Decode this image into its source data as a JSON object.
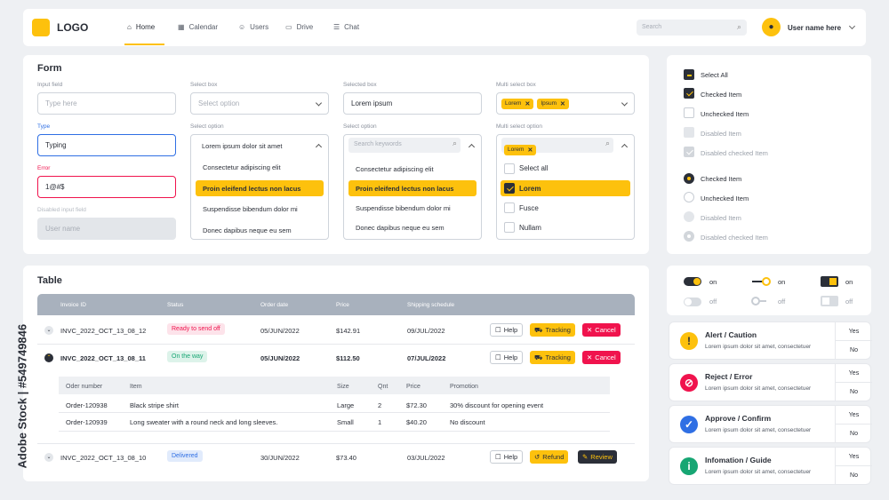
{
  "header": {
    "logo": "LOGO",
    "nav": [
      {
        "label": "Home",
        "icon": "home-icon"
      },
      {
        "label": "Calendar",
        "icon": "calendar-icon"
      },
      {
        "label": "Users",
        "icon": "users-icon"
      },
      {
        "label": "Drive",
        "icon": "folder-icon"
      },
      {
        "label": "Chat",
        "icon": "chat-icon"
      }
    ],
    "search_placeholder": "Search",
    "user_name": "User name here"
  },
  "form": {
    "title": "Form",
    "input_field": {
      "label": "Input field",
      "placeholder": "Type here"
    },
    "type_field": {
      "label": "Type",
      "value": "Typing"
    },
    "error_field": {
      "label": "Error",
      "value": "1@#$"
    },
    "disabled_field": {
      "label": "Disabled input field",
      "placeholder": "User name"
    },
    "select_box": {
      "label": "Select box",
      "placeholder": "Select option"
    },
    "select_option": {
      "label": "Select option",
      "value": "Lorem ipsum dolor sit amet",
      "options": [
        "Consectetur adipiscing elit",
        "Proin eleifend lectus non lacus",
        "Suspendisse bibendum dolor mi",
        "Donec dapibus neque eu sem"
      ]
    },
    "selected_box": {
      "label": "Selected box",
      "value": "Lorem ipsum"
    },
    "search_select": {
      "label": "Select option",
      "placeholder": "Search keywords",
      "options": [
        "Consectetur adipiscing elit",
        "Proin eleifend lectus non lacus",
        "Suspendisse bibendum dolor mi",
        "Donec dapibus neque eu sem"
      ]
    },
    "multi_select": {
      "label": "Multi select box",
      "chips": [
        "Lorem",
        "Ipsum"
      ]
    },
    "multi_option": {
      "label": "Multi select option",
      "chip": "Lorem",
      "options": [
        "Select all",
        "Lorem",
        "Fusce",
        "Nullam"
      ]
    }
  },
  "checks": {
    "items": [
      "Select All",
      "Checked Item",
      "Unchecked Item",
      "Disabled Item",
      "Disabled checked Item"
    ],
    "radios": [
      "Checked Item",
      "Unchecked Item",
      "Disabled Item",
      "Disabled checked Item"
    ]
  },
  "toggles": {
    "on": "on",
    "off": "off"
  },
  "table": {
    "title": "Table",
    "headers": [
      "Invoice ID",
      "Status",
      "Order date",
      "Price",
      "Shipping schedule"
    ],
    "rows": [
      {
        "id": "INVC_2022_OCT_13_08_12",
        "status": "Ready to send off",
        "date": "05/JUN/2022",
        "price": "$142.91",
        "ship": "09/JUL/2022",
        "b1": "Help",
        "b2": "Tracking",
        "b3": "Cancel"
      },
      {
        "id": "INVC_2022_OCT_13_08_11",
        "status": "On the way",
        "date": "05/JUN/2022",
        "price": "$112.50",
        "ship": "07/JUL/2022",
        "b1": "Help",
        "b2": "Tracking",
        "b3": "Cancel"
      },
      {
        "id": "INVC_2022_OCT_13_08_10",
        "status": "Delivered",
        "date": "30/JUN/2022",
        "price": "$73.40",
        "ship": "03/JUL/2022",
        "b1": "Help",
        "b2": "Refund",
        "b3": "Review"
      }
    ],
    "sub_headers": [
      "Oder number",
      "Item",
      "Size",
      "Qnt",
      "Price",
      "Promotion"
    ],
    "sub_rows": [
      {
        "num": "Order-120938",
        "item": "Black stripe shirt",
        "size": "Large",
        "qnt": "2",
        "price": "$72.30",
        "promo": "30% discount for opening event"
      },
      {
        "num": "Order-120939",
        "item": "Long sweater with a round neck and long sleeves.",
        "size": "Small",
        "qnt": "1",
        "price": "$40.20",
        "promo": "No discount"
      }
    ]
  },
  "alerts": [
    {
      "title": "Alert / Caution",
      "text": "Lorem ipsum dolor sit amet, consectetuer",
      "yes": "Yes",
      "no": "No",
      "color": "#fdc10d",
      "icon": "!"
    },
    {
      "title": "Reject / Error",
      "text": "Lorem ipsum dolor sit amet, consectetuer",
      "yes": "Yes",
      "no": "No",
      "color": "#f0134d",
      "icon": "⊘"
    },
    {
      "title": "Approve / Confirm",
      "text": "Lorem ipsum dolor sit amet, consectetuer",
      "yes": "Yes",
      "no": "No",
      "color": "#2f6fe4",
      "icon": "✓"
    },
    {
      "title": "Infomation / Guide",
      "text": "Lorem ipsum dolor sit amet, consectetuer",
      "yes": "Yes",
      "no": "No",
      "color": "#17a673",
      "icon": "i"
    }
  ],
  "watermark": "Adobe Stock | #549749846",
  "colors": {
    "accent": "#fdc10d",
    "dark": "#2b2f38",
    "error": "#f0134d",
    "focus": "#2f6fe4"
  }
}
